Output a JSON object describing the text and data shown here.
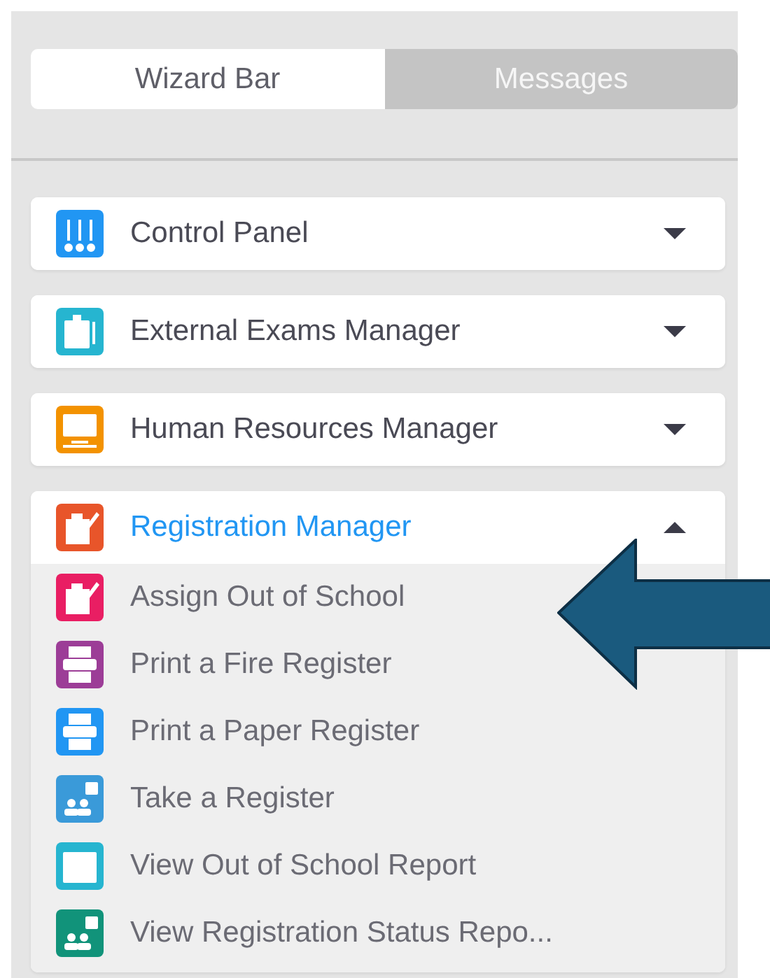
{
  "tabs": [
    {
      "label": "Wizard Bar",
      "selected": true
    },
    {
      "label": "Messages",
      "selected": false
    }
  ],
  "modules": [
    {
      "title": "Control Panel",
      "kind": "sliders",
      "color": "#2196f3",
      "expanded": false
    },
    {
      "title": "External Exams Manager",
      "kind": "clipboard",
      "color": "#26b5d0",
      "expanded": false
    },
    {
      "title": "Human Resources Manager",
      "kind": "monitor",
      "color": "#f39200",
      "expanded": false
    },
    {
      "title": "Registration Manager",
      "kind": "edit",
      "color": "#e8552a",
      "expanded": true,
      "items": [
        {
          "label": "Assign Out of School",
          "kind": "edit",
          "color": "#e91e63"
        },
        {
          "label": "Print a Fire Register",
          "kind": "printer",
          "color": "#9c3d97"
        },
        {
          "label": "Print a Paper Register",
          "kind": "printer",
          "color": "#2196f3"
        },
        {
          "label": "Take a Register",
          "kind": "people",
          "color": "#3a9ad9"
        },
        {
          "label": "View Out of School Report",
          "kind": "card",
          "color": "#26b5d0"
        },
        {
          "label": "View Registration Status Repo...",
          "kind": "people",
          "color": "#11937a"
        }
      ]
    }
  ]
}
